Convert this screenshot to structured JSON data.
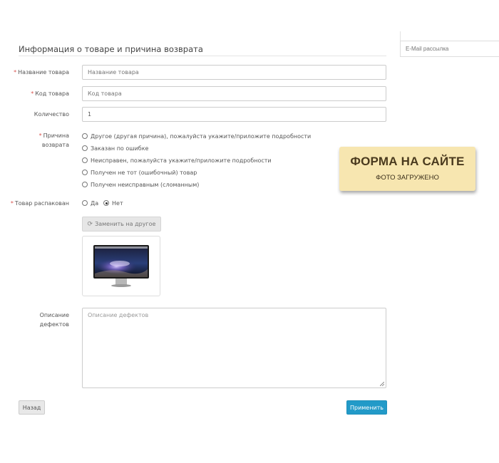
{
  "form": {
    "legend": "Информация о товаре и причина возврата",
    "required_mark": "*",
    "fields": {
      "product_name": {
        "label": "Название товара",
        "placeholder": "Название товара",
        "value": ""
      },
      "product_code": {
        "label": "Код товара",
        "placeholder": "Код товара",
        "value": ""
      },
      "quantity": {
        "label": "Количество",
        "value": "1"
      },
      "reason": {
        "label_line1": "Причина",
        "label_line2": "возврата",
        "options": [
          "Другое (другая причина), пожалуйста укажите/приложите подробности",
          "Заказан по ошибке",
          "Неисправен, пожалуйста укажите/приложите подробности",
          "Получен не тот (ошибочный) товар",
          "Получен неисправным (сломанным)"
        ],
        "selected_index": null
      },
      "opened": {
        "label": "Товар распакован",
        "options": [
          "Да",
          "Нет"
        ],
        "selected": "Нет"
      },
      "defects": {
        "label_line1": "Описание",
        "label_line2": "дефектов",
        "placeholder": "Описание дефектов"
      }
    },
    "replace_button": "Заменить на другое",
    "replace_icon": "refresh-icon",
    "back_button": "Назад",
    "apply_button": "Применить"
  },
  "sidebar": {
    "email_placeholder": "E-Mail рассылка"
  },
  "badge": {
    "title": "ФОРМА НА САЙТЕ",
    "subtitle": "ФОТО ЗАГРУЖЕНО"
  },
  "colors": {
    "primary": "#229ac8",
    "required": "#d9534f",
    "badge_bg": "#f7e6b0"
  }
}
